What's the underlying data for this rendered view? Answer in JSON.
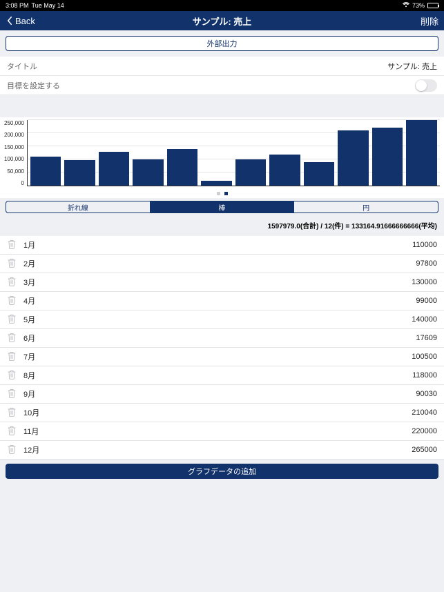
{
  "statusbar": {
    "time": "3:08 PM",
    "date": "Tue May 14",
    "battery": "73%"
  },
  "nav": {
    "back": "Back",
    "title": "サンプル: 売上",
    "delete": "削除"
  },
  "export_button": "外部出力",
  "title_row": {
    "label": "タイトル",
    "value": "サンプル: 売上"
  },
  "goal_row": {
    "label": "目標を設定する"
  },
  "segments": {
    "line": "折れ線",
    "bar": "棒",
    "pie": "円"
  },
  "summary": "1597979.0(合計) / 12(件) = 133164.91666666666(平均)",
  "add_button": "グラフデータの追加",
  "chart_data": {
    "type": "bar",
    "title": "",
    "xlabel": "",
    "ylabel": "",
    "ylim": [
      0,
      250000
    ],
    "yticks": [
      0,
      50000,
      100000,
      150000,
      200000,
      250000
    ],
    "ytick_labels": [
      "0",
      "50,000",
      "100,000",
      "150,000",
      "200,000",
      "250,000"
    ],
    "categories": [
      "1月",
      "2月",
      "3月",
      "4月",
      "5月",
      "6月",
      "7月",
      "8月",
      "9月",
      "10月",
      "11月",
      "12月"
    ],
    "values": [
      110000,
      97800,
      130000,
      99000,
      140000,
      17609,
      100500,
      118000,
      90030,
      210040,
      220000,
      265000
    ]
  },
  "rows": [
    {
      "label": "1月",
      "value": "110000"
    },
    {
      "label": "2月",
      "value": "97800"
    },
    {
      "label": "3月",
      "value": "130000"
    },
    {
      "label": "4月",
      "value": "99000"
    },
    {
      "label": "5月",
      "value": "140000"
    },
    {
      "label": "6月",
      "value": "17609"
    },
    {
      "label": "7月",
      "value": "100500"
    },
    {
      "label": "8月",
      "value": "118000"
    },
    {
      "label": "9月",
      "value": "90030"
    },
    {
      "label": "10月",
      "value": "210040"
    },
    {
      "label": "11月",
      "value": "220000"
    },
    {
      "label": "12月",
      "value": "265000"
    }
  ]
}
